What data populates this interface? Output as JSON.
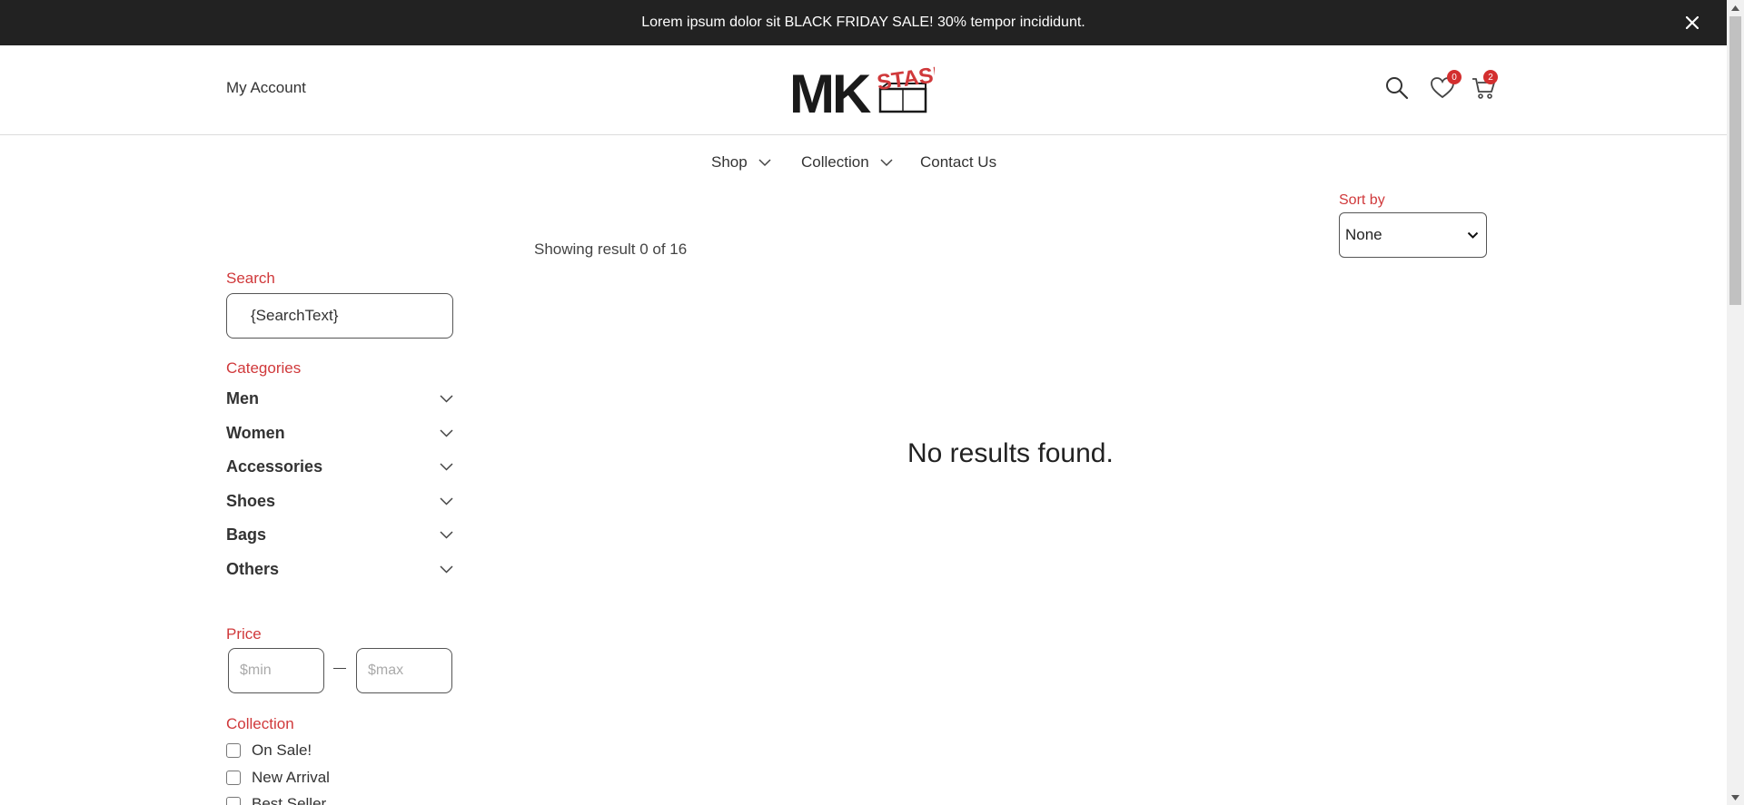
{
  "announcement": {
    "text": "Lorem ipsum dolor sit BLACK FRIDAY SALE! 30% tempor incididunt.",
    "close_icon": "close-icon"
  },
  "header": {
    "account_label": "My Account",
    "logo_text": "MK",
    "logo_accent": "STASH",
    "wishlist_count": "0",
    "cart_count": "2"
  },
  "nav": {
    "items": [
      {
        "label": "Shop",
        "has_dropdown": true
      },
      {
        "label": "Collection",
        "has_dropdown": true
      },
      {
        "label": "Contact Us",
        "has_dropdown": false
      }
    ]
  },
  "sort": {
    "label": "Sort by",
    "selected": "None"
  },
  "results": {
    "count_text": "Showing result 0 of 16",
    "empty_message": "No results found."
  },
  "sidebar": {
    "search_label": "Search",
    "search_value": "{SearchText}",
    "categories_label": "Categories",
    "categories": [
      {
        "name": "Men"
      },
      {
        "name": "Women"
      },
      {
        "name": "Accessories"
      },
      {
        "name": "Shoes"
      },
      {
        "name": "Bags"
      },
      {
        "name": "Others"
      }
    ],
    "price_label": "Price",
    "price_min_placeholder": "$min",
    "price_max_placeholder": "$max",
    "collection_label": "Collection",
    "collection_options": [
      {
        "label": "On Sale!",
        "checked": false
      },
      {
        "label": "New Arrival",
        "checked": false
      },
      {
        "label": "Best Seller",
        "checked": false
      }
    ]
  },
  "colors": {
    "accent": "#d0393b",
    "announcement_bg": "#222222",
    "badge": "#d32f2f"
  }
}
